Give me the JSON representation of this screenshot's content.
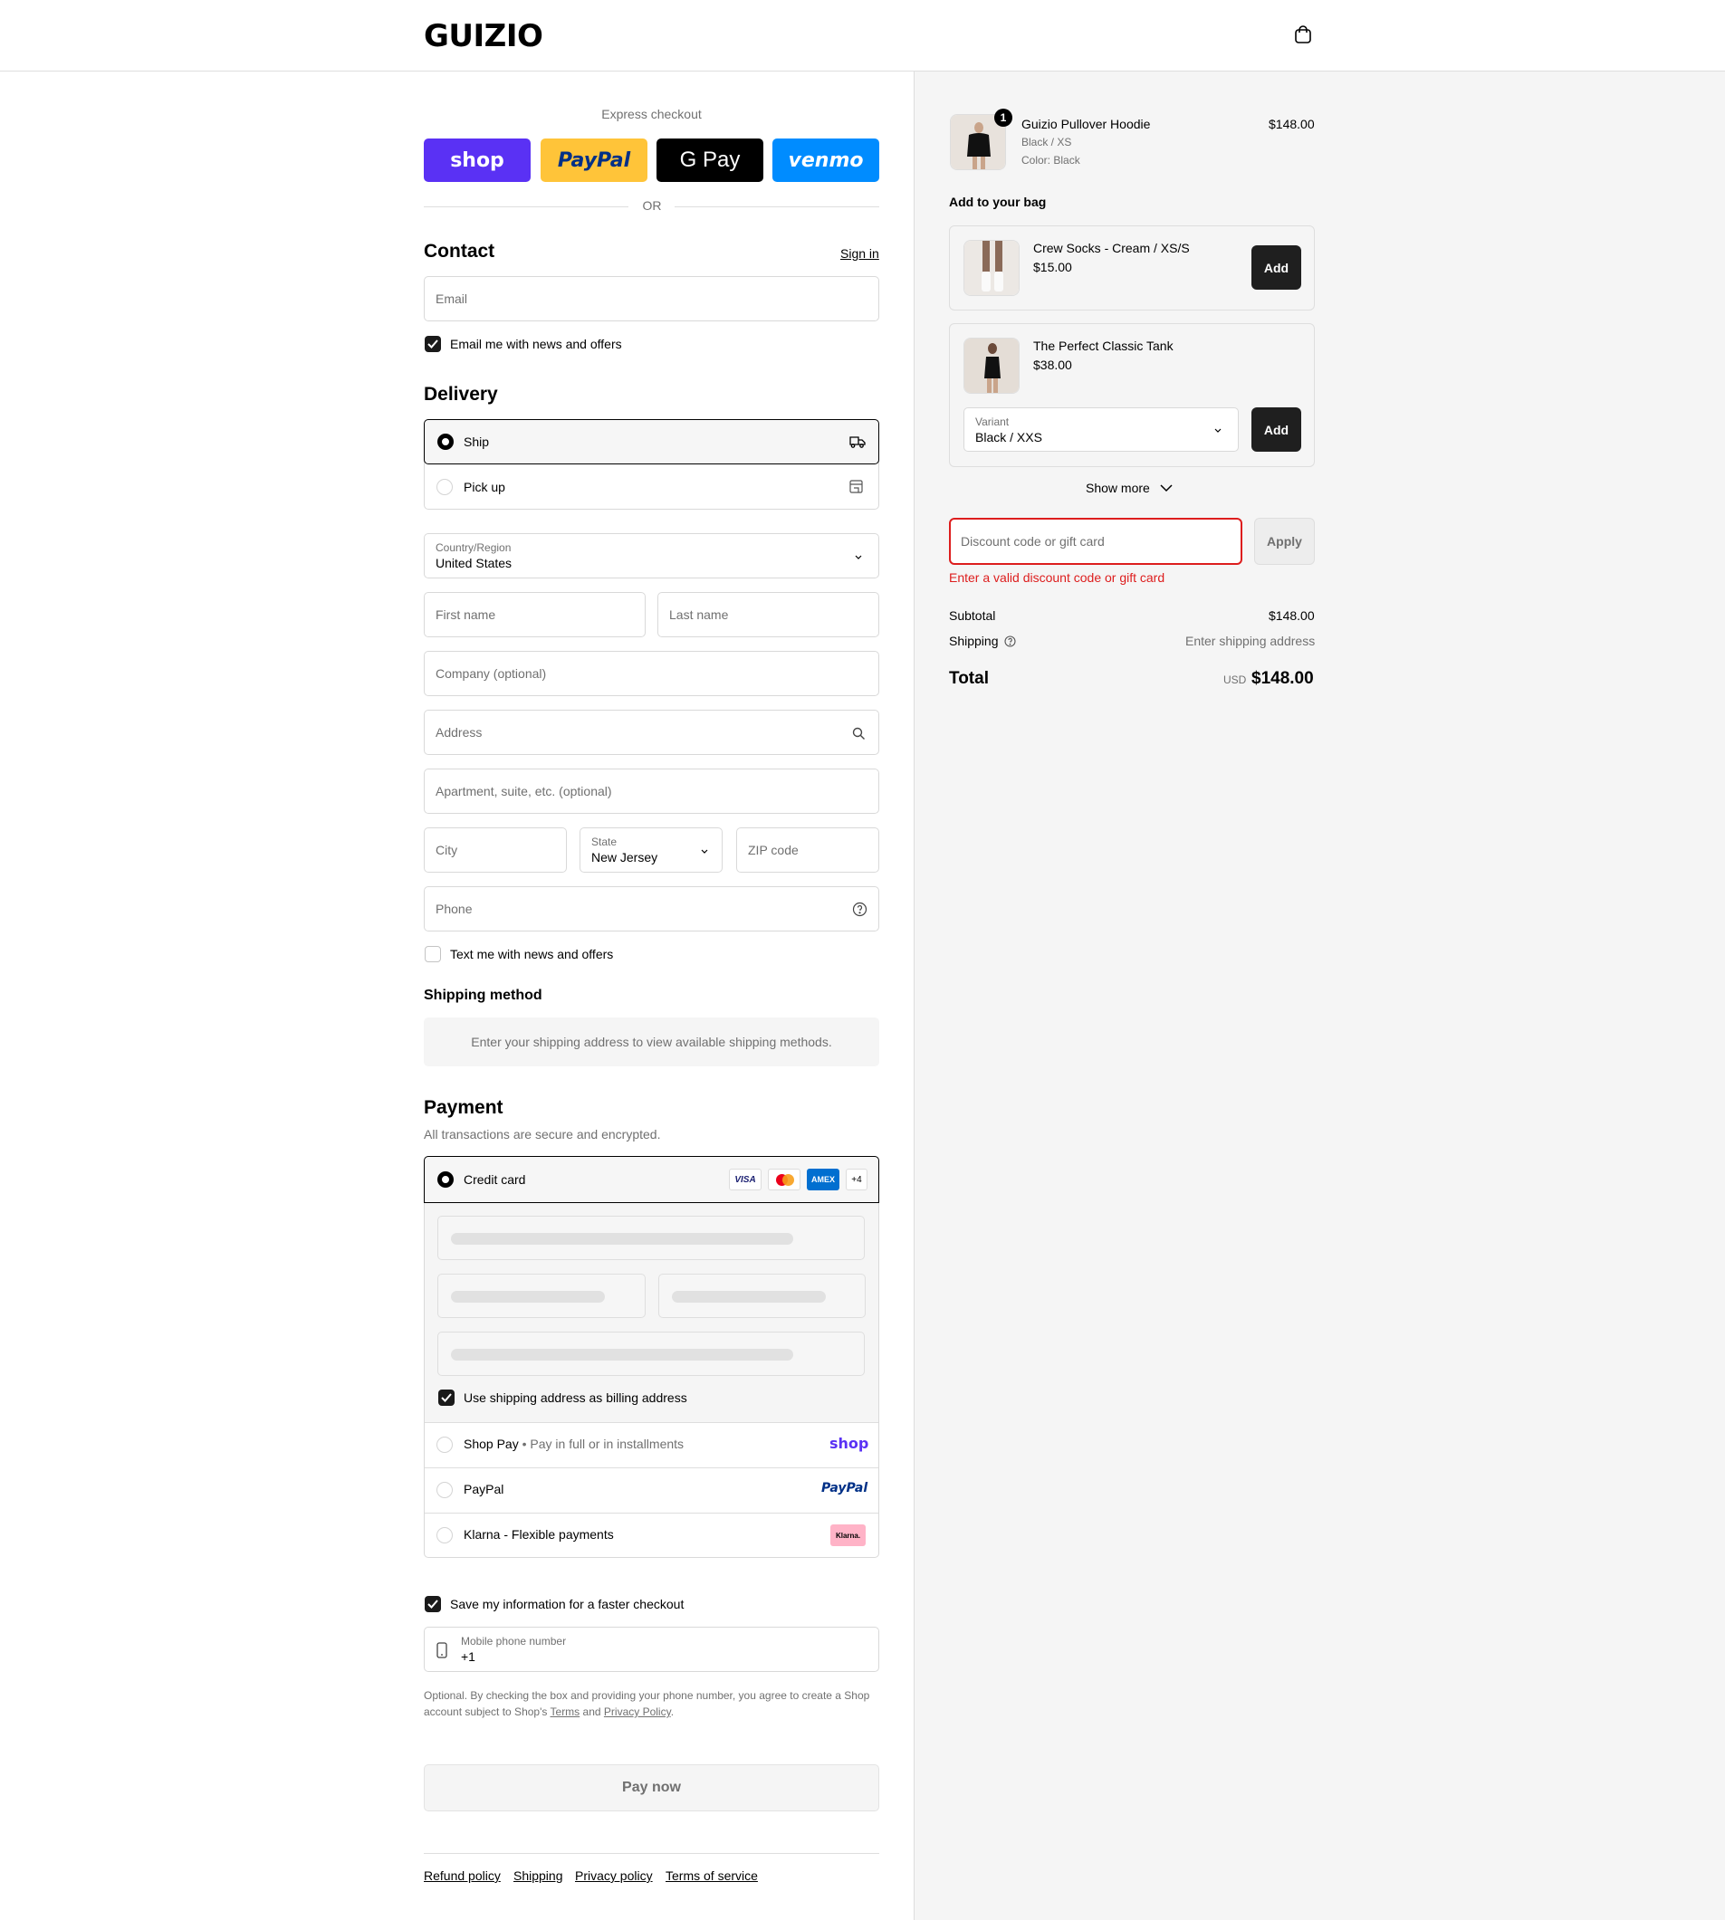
{
  "header": {
    "logo": "GUIZIO",
    "bag_icon": "bag-icon"
  },
  "express": {
    "label": "Express checkout",
    "buttons": [
      {
        "label": "shop",
        "bg": "#5a31f4",
        "fg": "#ffffff"
      },
      {
        "label": "PayPal",
        "bg": "#ffc439",
        "fg": "#003087"
      },
      {
        "label": "G Pay",
        "bg": "#000000",
        "fg": "#ffffff"
      },
      {
        "label": "venmo",
        "bg": "#008cff",
        "fg": "#ffffff"
      }
    ],
    "or": "OR"
  },
  "contact": {
    "title": "Contact",
    "sign_in": "Sign in",
    "email_placeholder": "Email",
    "newsletter_label": "Email me with news and offers",
    "newsletter_checked": true
  },
  "delivery": {
    "title": "Delivery",
    "options": [
      {
        "label": "Ship",
        "selected": true,
        "icon": "truck-icon"
      },
      {
        "label": "Pick up",
        "selected": false,
        "icon": "store-icon"
      }
    ],
    "country_label": "Country/Region",
    "country_value": "United States",
    "first_name": "First name",
    "last_name": "Last name",
    "company": "Company (optional)",
    "address": "Address",
    "apartment": "Apartment, suite, etc. (optional)",
    "city": "City",
    "state_label": "State",
    "state_value": "New Jersey",
    "zip": "ZIP code",
    "phone": "Phone",
    "sms_label": "Text me with news and offers",
    "sms_checked": false
  },
  "shipping_method": {
    "title": "Shipping method",
    "message": "Enter your shipping address to view available shipping methods."
  },
  "payment": {
    "title": "Payment",
    "subtitle": "All transactions are secure and encrypted.",
    "credit_card_label": "Credit card",
    "card_brands": [
      "VISA",
      "mastercard",
      "AMEX",
      "+4"
    ],
    "billing_label": "Use shipping address as billing address",
    "billing_checked": true,
    "shop_pay_label": "Shop Pay",
    "shop_pay_sep": "•",
    "shop_pay_sub": "Pay in full or in installments",
    "shop_pay_logo": "shop",
    "paypal_label": "PayPal",
    "paypal_logo": "PayPal",
    "klarna_label": "Klarna - Flexible payments",
    "klarna_logo": "Klarna."
  },
  "remember": {
    "label": "Save my information for a faster checkout",
    "checked": true,
    "phone_label": "Mobile phone number",
    "phone_value": "+1",
    "disclaimer_1": "Optional. By checking the box and providing your phone number, you agree to create a Shop",
    "disclaimer_2": "account subject to Shop's",
    "terms": "Terms",
    "and": "and",
    "privacy": "Privacy Policy",
    "period": "."
  },
  "pay_now": "Pay now",
  "footer": [
    "Refund policy",
    "Shipping",
    "Privacy policy",
    "Terms of service"
  ],
  "summary": {
    "item": {
      "qty": "1",
      "name": "Guizio Pullover Hoodie",
      "variant": "Black / XS",
      "color": "Color: Black",
      "price": "$148.00"
    },
    "add_title": "Add to your bag",
    "upsell": [
      {
        "name": "Crew Socks - Cream / XS/S",
        "price": "$15.00",
        "add": "Add"
      },
      {
        "name": "The Perfect Classic Tank",
        "price": "$38.00",
        "add": "Add",
        "variant_label": "Variant",
        "variant_value": "Black / XXS"
      }
    ],
    "show_more": "Show more",
    "discount_placeholder": "Discount code or gift card",
    "apply": "Apply",
    "discount_error": "Enter a valid discount code or gift card",
    "subtotal_label": "Subtotal",
    "subtotal_value": "$148.00",
    "shipping_label": "Shipping",
    "shipping_value": "Enter shipping address",
    "total_label": "Total",
    "currency": "USD",
    "total_value": "$148.00"
  }
}
